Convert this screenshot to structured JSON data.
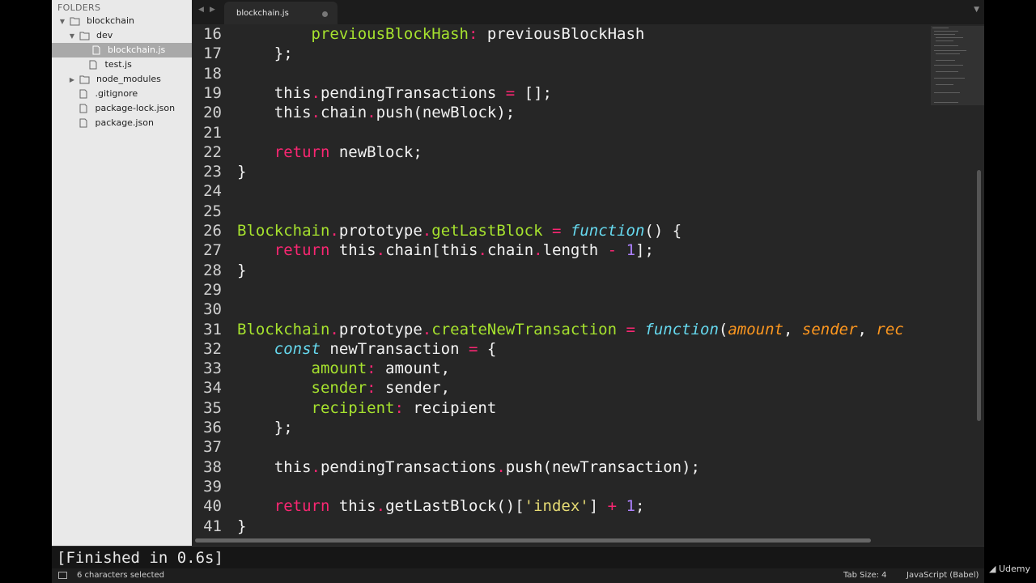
{
  "sidebar": {
    "header": "FOLDERS",
    "items": [
      {
        "label": "blockchain",
        "type": "folder-open"
      },
      {
        "label": "dev",
        "type": "folder-open"
      },
      {
        "label": "blockchain.js",
        "type": "file"
      },
      {
        "label": "test.js",
        "type": "file"
      },
      {
        "label": "node_modules",
        "type": "folder"
      },
      {
        "label": ".gitignore",
        "type": "file"
      },
      {
        "label": "package-lock.json",
        "type": "file"
      },
      {
        "label": "package.json",
        "type": "file"
      }
    ]
  },
  "tabbar": {
    "nav_back": "◀",
    "nav_forward": "▶",
    "active_tab": "blockchain.js",
    "dropdown": "▼"
  },
  "editor": {
    "line_numbers": [
      "16",
      "17",
      "18",
      "19",
      "20",
      "21",
      "22",
      "23",
      "24",
      "25",
      "26",
      "27",
      "28",
      "29",
      "30",
      "31",
      "32",
      "33",
      "34",
      "35",
      "36",
      "37",
      "38",
      "39",
      "40",
      "41"
    ],
    "code_lines": [
      "        previousBlockHash: previousBlockHash",
      "    };",
      "",
      "    this.pendingTransactions = [];",
      "    this.chain.push(newBlock);",
      "",
      "    return newBlock;",
      "}",
      "",
      "",
      "Blockchain.prototype.getLastBlock = function() {",
      "    return this.chain[this.chain.length - 1];",
      "}",
      "",
      "",
      "Blockchain.prototype.createNewTransaction = function(amount, sender, rec",
      "    const newTransaction = {",
      "        amount: amount,",
      "        sender: sender,",
      "        recipient: recipient",
      "    };",
      "",
      "    this.pendingTransactions.push(newTransaction);",
      "",
      "    return this.getLastBlock()['index'] + 1;",
      "}"
    ]
  },
  "output": {
    "text": "[Finished in 0.6s]"
  },
  "status": {
    "selection": "6 characters selected",
    "tab_size": "Tab Size: 4",
    "syntax": "JavaScript (Babel)"
  },
  "watermark": "Udemy",
  "colors": {
    "keyword": "#f92672",
    "function_name": "#a6e22e",
    "storage": "#66d9ef",
    "argument": "#fd971f",
    "string": "#e6db74",
    "number": "#ae81ff"
  }
}
